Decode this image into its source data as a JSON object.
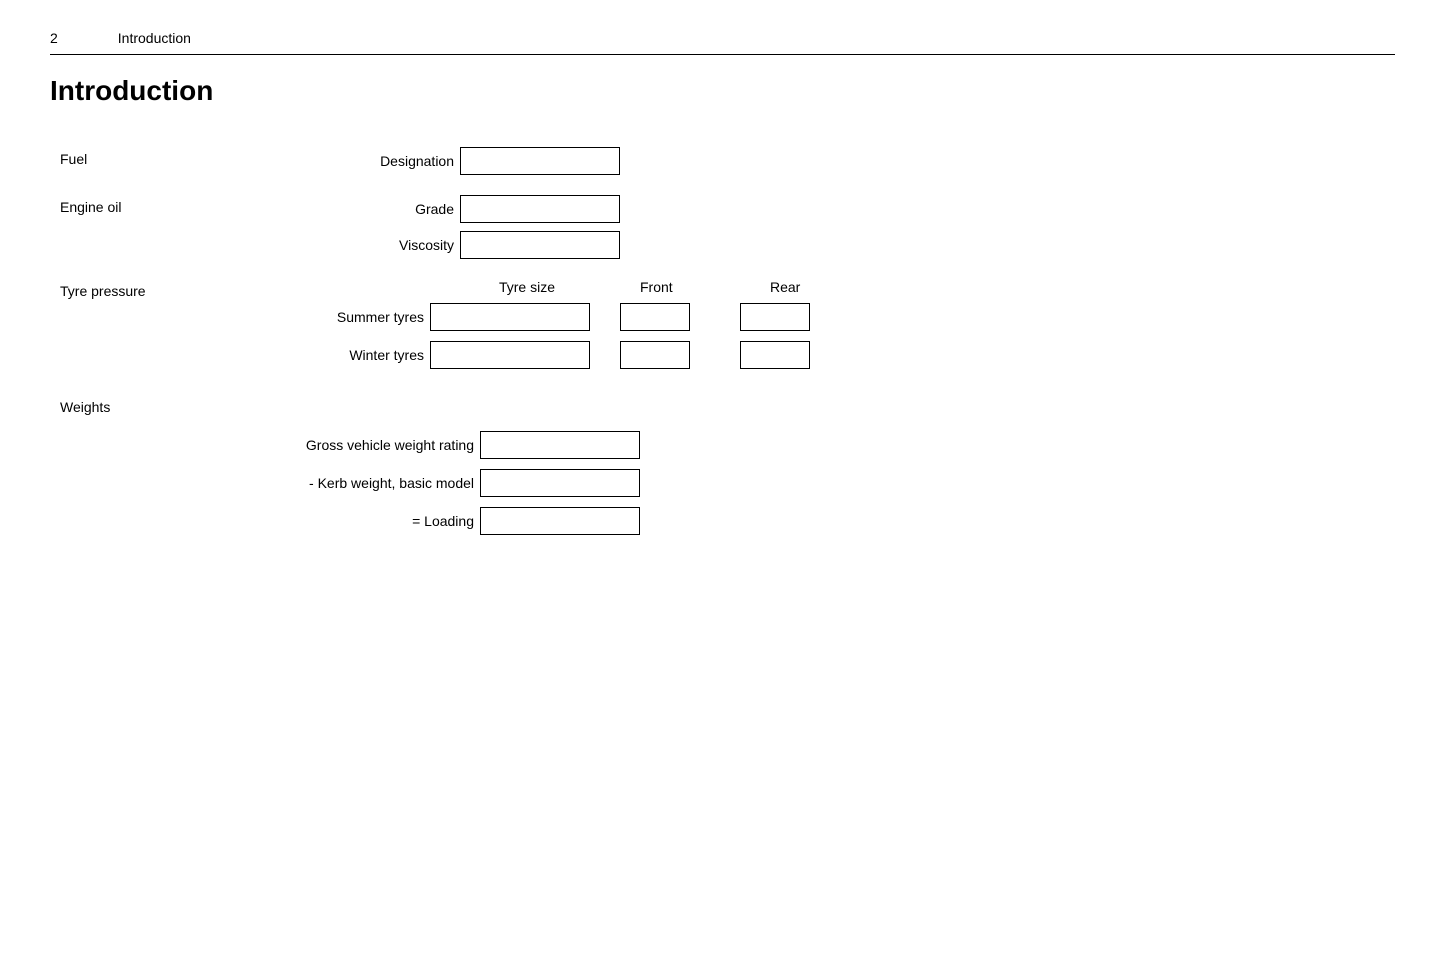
{
  "header": {
    "page_number": "2",
    "title": "Introduction"
  },
  "page_title": "Introduction",
  "sections": {
    "fuel": {
      "label": "Fuel",
      "fields": [
        {
          "label": "Designation",
          "value": ""
        }
      ]
    },
    "engine_oil": {
      "label": "Engine oil",
      "fields": [
        {
          "label": "Grade",
          "value": ""
        },
        {
          "label": "Viscosity",
          "value": ""
        }
      ]
    },
    "tyre_pressure": {
      "label": "Tyre pressure",
      "col_headers": {
        "tyre_size": "Tyre size",
        "front": "Front",
        "rear": "Rear"
      },
      "rows": [
        {
          "label": "Summer tyres"
        },
        {
          "label": "Winter tyres"
        }
      ]
    },
    "weights": {
      "label": "Weights",
      "fields": [
        {
          "label": "Gross vehicle weight rating",
          "value": ""
        },
        {
          "label": "- Kerb weight, basic model",
          "value": ""
        },
        {
          "label": "= Loading",
          "value": ""
        }
      ]
    }
  }
}
